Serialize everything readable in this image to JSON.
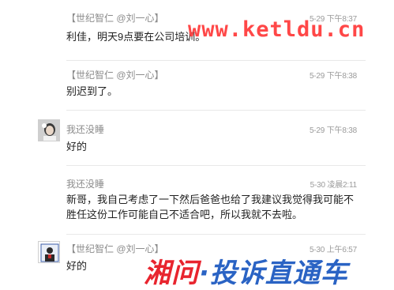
{
  "messages": [
    {
      "sender": "【世纪智仁 @刘一心】",
      "time": "5-29 下午8:37",
      "text": "利佳，明天9点要在公司培训。"
    },
    {
      "sender": "【世纪智仁 @刘一心】",
      "time": "5-29 下午8:38",
      "text": "别迟到了。"
    },
    {
      "sender": "我还没睡",
      "time": "5-29 下午8:38",
      "text": "好的"
    },
    {
      "sender": "我还没睡",
      "time": "5-30 凌晨2:11",
      "text_lines": [
        "新哥，我自己考虑了一下然后爸爸也给了我建议我觉得我可能不",
        "胜任这份工作可能自己不适合吧，所以我就不去啦。"
      ]
    },
    {
      "sender": "【世纪智仁 @刘一心】",
      "time": "5-30 上午6:57",
      "text": "好的"
    }
  ],
  "watermarks": {
    "top": "www.ketldu.cn",
    "bottom_part1": "湘问",
    "bottom_part2": "·投诉直通车"
  },
  "colors": {
    "sender": "#8c8c8c",
    "text": "#1f1f1f",
    "watermark_red": "#e8242e",
    "watermark_blue": "#2a63c4"
  }
}
